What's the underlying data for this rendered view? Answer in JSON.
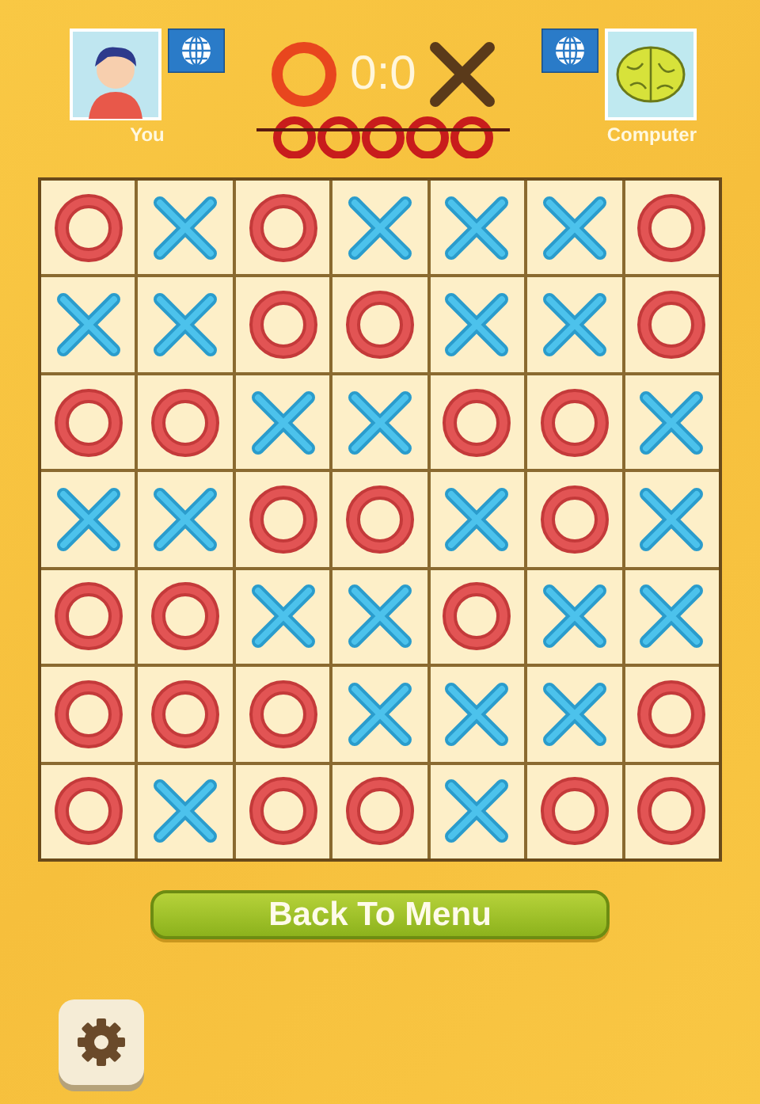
{
  "players": [
    {
      "name": "You",
      "kind": "person"
    },
    {
      "name": "Computer",
      "kind": "brain"
    }
  ],
  "score": "0:0",
  "board": [
    [
      {
        "kind": "o"
      },
      {
        "kind": "x"
      },
      {
        "kind": "o"
      },
      {
        "kind": "x"
      },
      {
        "kind": "x"
      },
      {
        "kind": "x"
      },
      {
        "kind": "o"
      }
    ],
    [
      {
        "kind": "x"
      },
      {
        "kind": "x"
      },
      {
        "kind": "o"
      },
      {
        "kind": "o"
      },
      {
        "kind": "x"
      },
      {
        "kind": "x"
      },
      {
        "kind": "o"
      }
    ],
    [
      {
        "kind": "o"
      },
      {
        "kind": "o"
      },
      {
        "kind": "x"
      },
      {
        "kind": "x"
      },
      {
        "kind": "o"
      },
      {
        "kind": "o"
      },
      {
        "kind": "x"
      }
    ],
    [
      {
        "kind": "x"
      },
      {
        "kind": "x"
      },
      {
        "kind": "o"
      },
      {
        "kind": "o"
      },
      {
        "kind": "x"
      },
      {
        "kind": "o"
      },
      {
        "kind": "x"
      }
    ],
    [
      {
        "kind": "o"
      },
      {
        "kind": "o"
      },
      {
        "kind": "x"
      },
      {
        "kind": "x"
      },
      {
        "kind": "o"
      },
      {
        "kind": "x"
      },
      {
        "kind": "x"
      }
    ],
    [
      {
        "kind": "o"
      },
      {
        "kind": "o"
      },
      {
        "kind": "o"
      },
      {
        "kind": "x"
      },
      {
        "kind": "x"
      },
      {
        "kind": "x"
      },
      {
        "kind": "o"
      }
    ],
    [
      {
        "kind": "o"
      },
      {
        "kind": "x"
      },
      {
        "kind": "o"
      },
      {
        "kind": "o"
      },
      {
        "kind": "x"
      },
      {
        "kind": "o"
      },
      {
        "kind": "o"
      }
    ]
  ],
  "back_button": "Back To Menu"
}
